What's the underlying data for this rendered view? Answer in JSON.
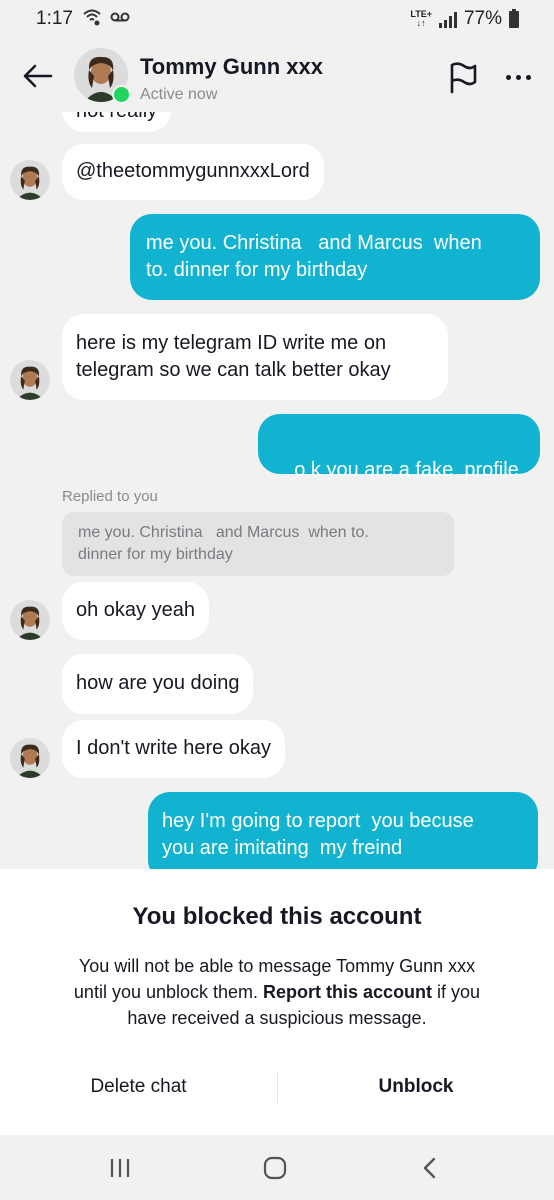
{
  "status_bar": {
    "time": "1:17",
    "lte_top": "LTE+",
    "lte_bottom": "↓↑",
    "battery": "77%"
  },
  "header": {
    "name": "Tommy Gunn xxx",
    "status": "Active now",
    "icons": [
      "back-arrow-icon",
      "flag-icon",
      "more-icon"
    ],
    "online_color": "#20d55f"
  },
  "messages": [
    {
      "side": "in",
      "text": "not really"
    },
    {
      "side": "in",
      "text": "@theetommygunnxxxLord"
    },
    {
      "side": "out",
      "text_line1": "me you. Christina   and Marcus  when",
      "text_line2": "to. dinner for my birthday"
    },
    {
      "side": "in",
      "text_line1": "here is my telegram ID write me on",
      "text_line2": "telegram so we can talk better okay"
    },
    {
      "side": "out",
      "text": "o k you are a fake  profile"
    },
    {
      "side": "in",
      "reply_label": "Replied to you",
      "quote_line1": "me you. Christina   and Marcus  when to.",
      "quote_line2": "dinner for my birthday",
      "text": "oh okay yeah"
    },
    {
      "side": "in",
      "text": "how are you doing"
    },
    {
      "side": "in",
      "text": "I don't write here okay"
    },
    {
      "side": "out",
      "text_line1": "hey I'm going to report  you becuse",
      "text_line2": "you are imitating  my freind"
    }
  ],
  "blocked": {
    "title": "You blocked this account",
    "desc_line1": "You will not be able to message Tommy Gunn xxx",
    "desc_line2a": "until you unblock them. ",
    "desc_report": "Report this account",
    "desc_line2b": " if you",
    "desc_line3": "have received a suspicious message.",
    "delete_label": "Delete chat",
    "unblock_label": "Unblock"
  },
  "colors": {
    "outgoing_bubble": "#11b3d1",
    "incoming_bubble": "#ffffff",
    "background": "#f1f1f2"
  }
}
